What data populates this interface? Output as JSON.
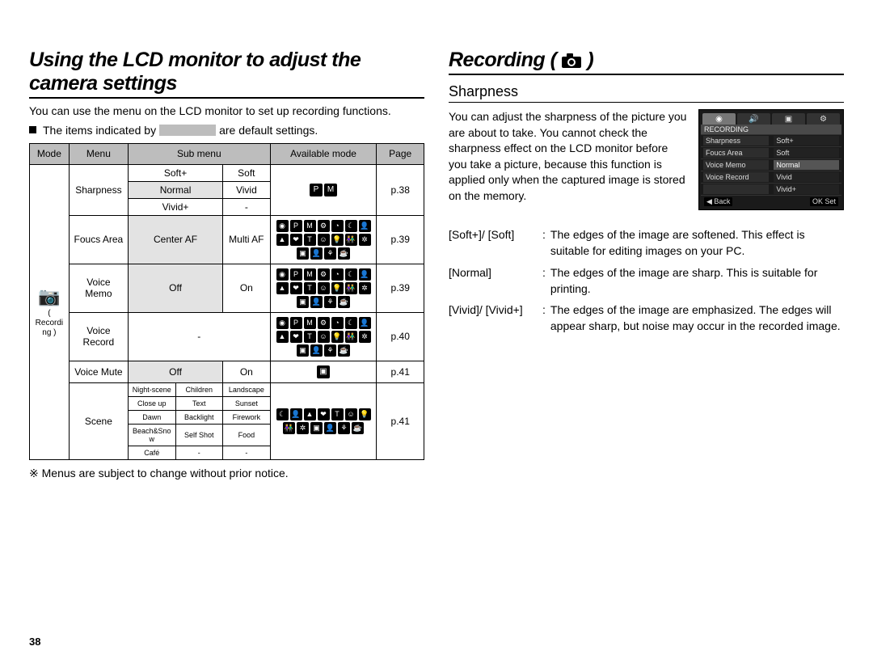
{
  "left": {
    "title": "Using the LCD monitor to adjust the camera settings",
    "intro": "You can use the menu on the LCD monitor to set up recording functions.",
    "bullet_pre": "The items indicated by",
    "bullet_post": "are default settings.",
    "table_headers": {
      "mode": "Mode",
      "menu": "Menu",
      "sub": "Sub menu",
      "avail": "Available mode",
      "page": "Page"
    },
    "mode_label": "( Recording )",
    "rows": {
      "sharpness": {
        "menu": "Sharpness",
        "sub": {
          "softp": "Soft+",
          "soft": "Soft",
          "normal": "Normal",
          "vivid": "Vivid",
          "vividp": "Vivid+",
          "dash": "-"
        },
        "page": "p.38"
      },
      "focus": {
        "menu": "Foucs Area",
        "center": "Center AF",
        "multi": "Multi AF",
        "page": "p.39"
      },
      "voicememo": {
        "menu": "Voice Memo",
        "off": "Off",
        "on": "On",
        "page": "p.39"
      },
      "voicerecord": {
        "menu": "Voice Record",
        "dash": "-",
        "page": "p.40"
      },
      "voicemute": {
        "menu": "Voice Mute",
        "off": "Off",
        "on": "On",
        "page": "p.41"
      },
      "scene": {
        "menu": "Scene",
        "cells": [
          "Night-scene",
          "Children",
          "Landscape",
          "Close up",
          "Text",
          "Sunset",
          "Dawn",
          "Backlight",
          "Firework",
          "Beach&Snow",
          "Self Shot",
          "Food",
          "Café",
          "-",
          "-"
        ],
        "page": "p.41"
      }
    },
    "mode_icons": {
      "sharp": [
        "P",
        "M"
      ],
      "big": [
        "◉",
        "P",
        "M",
        "⚙",
        "◔",
        "☾",
        "👤",
        "▲",
        "❤",
        "T",
        "☺",
        "💡",
        "👫",
        "✲",
        "▣",
        "👤",
        "⚘",
        "☕"
      ],
      "mid": [
        "◉",
        "P",
        "M",
        "⚙",
        "◔",
        "☾",
        "👤",
        "▲",
        "❤",
        "T",
        "☺",
        "💡",
        "👫",
        "✲",
        "▣",
        "👤",
        "⚘",
        "☕"
      ],
      "rec": [
        "◉",
        "P",
        "M",
        "⚙",
        "◔",
        "☾",
        "👤",
        "▲",
        "❤",
        "T",
        "☺",
        "💡",
        "👫",
        "✲",
        "▣",
        "👤",
        "⚘",
        "☕"
      ],
      "mute": [
        "▣"
      ],
      "scene": [
        "☾",
        "👤",
        "▲",
        "❤",
        "T",
        "☺",
        "💡",
        "👫",
        "✲",
        "▣",
        "👤",
        "⚘",
        "☕"
      ]
    },
    "note": "※ Menus are subject to change without prior notice.",
    "page_num": "38"
  },
  "right": {
    "title_text": "Recording (",
    "title_end": ")",
    "subtitle": "Sharpness",
    "para": "You can adjust the sharpness of the picture you are about to take. You cannot check the sharpness effect on the LCD monitor before you take a picture, because this function is applied only when the captured image is stored on the memory.",
    "lcd": {
      "title": "RECORDING",
      "rows": [
        {
          "l": "Sharpness",
          "r": "Soft+"
        },
        {
          "l": "Foucs Area",
          "r": "Soft"
        },
        {
          "l": "Voice Memo",
          "r": "Normal",
          "sel": true
        },
        {
          "l": "Voice Record",
          "r": "Vivid"
        },
        {
          "l": "",
          "r": "Vivid+"
        }
      ],
      "foot_l": "◀  Back",
      "foot_r": "OK  Set"
    },
    "defs": [
      {
        "term": "[Soft+]/ [Soft]",
        "desc": "The edges of the image are softened. This effect is suitable for editing images on your PC."
      },
      {
        "term": "[Normal]",
        "desc": "The edges of the image are sharp. This is suitable for printing."
      },
      {
        "term": "[Vivid]/ [Vivid+]",
        "desc": "The edges of the image are emphasized. The edges will appear sharp, but noise may occur in the recorded image."
      }
    ]
  }
}
